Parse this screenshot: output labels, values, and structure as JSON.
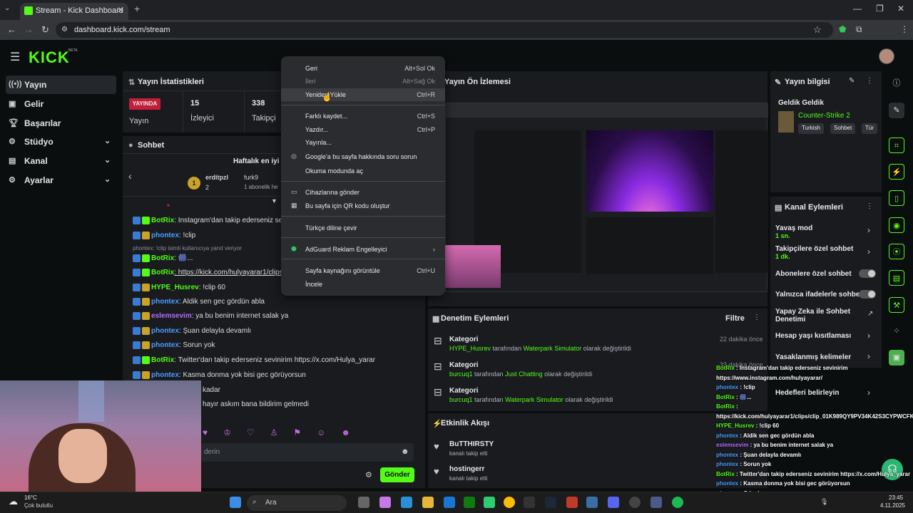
{
  "browser": {
    "tab_title": "Stream - Kick Dashboard",
    "url": "dashboard.kick.com/stream",
    "profile_initial": "H"
  },
  "header": {
    "logo": "KICK",
    "beta": "BETA"
  },
  "sidebar": {
    "items": [
      {
        "label": "Yayın",
        "icon": "radio-icon"
      },
      {
        "label": "Gelir",
        "icon": "money-icon"
      },
      {
        "label": "Başarılar",
        "icon": "trophy-icon"
      },
      {
        "label": "Stüdyo",
        "icon": "studio-icon"
      },
      {
        "label": "Kanal",
        "icon": "channel-icon"
      },
      {
        "label": "Ayarlar",
        "icon": "gear-icon"
      }
    ]
  },
  "stats": {
    "title": "Yayın İstatistikleri",
    "live_badge": "YAYINDA",
    "live_label": "Yayın",
    "viewers_value": "15",
    "viewers_label": "İzleyici",
    "followers_value": "338",
    "followers_label": "Takipçi"
  },
  "chat": {
    "title": "Sohbet",
    "top_title": "Haftalık en iyi h",
    "top1_name": "erditpzl",
    "top1_count": "2",
    "top2_name": "furk9",
    "top2_sub": "1 abonelik he",
    "reply_note": "phontex: !clip isimli kullanıcıya yanıt veriyor",
    "messages": [
      {
        "user": "BotRix",
        "text": ": Instagram'dan takip ederseniz sevi",
        "color": "#53fc18"
      },
      {
        "user": "phontex",
        "text": ": !clip",
        "color": "#4a9eff"
      },
      {
        "user": "BotRix",
        "text": ": 🎆...",
        "color": "#53fc18"
      },
      {
        "user": "BotRix",
        "text": ": https://kick.com/hulyayarar1/clips/c",
        "color": "#53fc18"
      },
      {
        "user": "HYPE_Husrev",
        "text": ": !clip 60",
        "color": "#53fc18"
      },
      {
        "user": "phontex",
        "text": ": Aldik sen gec gördün abla",
        "color": "#4a9eff"
      },
      {
        "user": "eslemsevim",
        "text": ": ya bu benim internet salak ya",
        "color": "#b56cff"
      },
      {
        "user": "phontex",
        "text": ": Şuan delayla devamlı",
        "color": "#4a9eff"
      },
      {
        "user": "phontex",
        "text": ": Sorun yok",
        "color": "#4a9eff"
      },
      {
        "user": "BotRix",
        "text": ": Twitter'dan takip ederseniz sevinirim https://x.com/Hulya_yarar",
        "color": "#53fc18"
      },
      {
        "user": "phontex",
        "text": ": Kasma donma yok bisi gec görüyorsun",
        "color": "#4a9eff"
      }
    ],
    "partial1": "kadar",
    "partial2": "hayır askım bana bildirim gelmedi",
    "input_placeholder": "derin",
    "send_label": "Gönder"
  },
  "preview": {
    "title": "Yayın Ön İzlemesi"
  },
  "info": {
    "title": "Yayın bilgisi",
    "stream_title": "Geldik Geldik",
    "category": "Counter-Strike 2",
    "tags": [
      "Turkish",
      "Sohbet",
      "Tür"
    ]
  },
  "actions": {
    "title": "Kanal Eylemleri",
    "items": [
      {
        "label": "Yavaş mod",
        "sub": "1 sn.",
        "kind": "chev"
      },
      {
        "label": "Takipçilere özel sohbet",
        "sub": "1 dk.",
        "kind": "chev"
      },
      {
        "label": "Abonelere özel sohbet",
        "sub": "",
        "kind": "toggle"
      },
      {
        "label": "Yalnızca ifadelerle sohbet",
        "sub": "",
        "kind": "toggle"
      },
      {
        "label": "Yapay Zeka ile Sohbet Denetimi",
        "sub": "",
        "kind": "ext"
      },
      {
        "label": "Hesap yaşı kısıtlaması",
        "sub": "",
        "kind": "chev"
      },
      {
        "label": "Yasaklanmış kelimeler",
        "sub": "",
        "kind": "chev"
      },
      {
        "label": "Hedefleri belirleyin",
        "sub": "",
        "kind": "chev"
      }
    ]
  },
  "moderation": {
    "title": "Denetim Eylemleri",
    "filter": "Filtre",
    "items": [
      {
        "head": "Kategori",
        "by": "HYPE_Husrev",
        "mid": " tarafından ",
        "cat": "Waterpark Simulator",
        "tail": " olarak değiştirildi",
        "time": "22 dakika önce"
      },
      {
        "head": "Kategori",
        "by": "burcuq1",
        "mid": " tarafından ",
        "cat": "Just Chatting",
        "tail": " olarak değiştirildi",
        "time": "33 dakika önce"
      },
      {
        "head": "Kategori",
        "by": "burcuq1",
        "mid": " tarafından ",
        "cat": "Waterpark Simulator",
        "tail": " olarak değiştirildi",
        "time": ""
      }
    ]
  },
  "activity": {
    "title": "Etkinlik Akışı",
    "items": [
      {
        "name": "BuTTHIRSTY",
        "text": "kanalı takip etti"
      },
      {
        "name": "hostingerr",
        "text": "kanalı takip etti"
      }
    ]
  },
  "context_menu": {
    "items": [
      {
        "label": "Geri",
        "shortcut": "Alt+Sol Ok",
        "disabled": false
      },
      {
        "label": "İleri",
        "shortcut": "Alt+Sağ Ok",
        "disabled": true
      },
      {
        "label": "Yeniden Yükle",
        "shortcut": "Ctrl+R",
        "disabled": false
      },
      {
        "label": "Farklı kaydet...",
        "shortcut": "Ctrl+S",
        "disabled": false
      },
      {
        "label": "Yazdır...",
        "shortcut": "Ctrl+P",
        "disabled": false
      },
      {
        "label": "Yayınla...",
        "shortcut": "",
        "disabled": false
      },
      {
        "label": "Google'a bu sayfa hakkında soru sorun",
        "shortcut": "",
        "disabled": false
      },
      {
        "label": "Okuma modunda aç",
        "shortcut": "",
        "disabled": false
      },
      {
        "label": "Cihazlarına gönder",
        "shortcut": "",
        "disabled": false
      },
      {
        "label": "Bu sayfa için QR kodu oluştur",
        "shortcut": "",
        "disabled": false
      },
      {
        "label": "Türkçe diline çevir",
        "shortcut": "",
        "disabled": false
      },
      {
        "label": "AdGuard Reklam Engelleyici",
        "shortcut": "›",
        "disabled": false
      },
      {
        "label": "Sayfa kaynağını görüntüle",
        "shortcut": "Ctrl+U",
        "disabled": false
      },
      {
        "label": "İncele",
        "shortcut": "",
        "disabled": false
      }
    ]
  },
  "overlay_chat": [
    {
      "user": "BotRix",
      "text": " : Instagram'dan takip ederseniz sevinirim"
    },
    {
      "user": "",
      "text": "https://www.instagram.com/hulyayarar/"
    },
    {
      "user": "phontex",
      "text": " : !clip"
    },
    {
      "user": "BotRix",
      "text": " : 🎆..."
    },
    {
      "user": "BotRix",
      "text": " :"
    },
    {
      "user": "",
      "text": "https://kick.com/hulyayarar1/clips/clip_01K989QY9PV34K42S3CYPWCFKV"
    },
    {
      "user": "HYPE_Husrev",
      "text": " : !clip 60"
    },
    {
      "user": "phontex",
      "text": " : Aldik sen gec gördün abla"
    },
    {
      "user": "eslemsevim",
      "text": " : ya bu benim internet salak ya"
    },
    {
      "user": "phontex",
      "text": " : Şuan delayla devamlı"
    },
    {
      "user": "phontex",
      "text": " : Sorun yok"
    },
    {
      "user": "BotRix",
      "text": " : Twitter'dan takip ederseniz sevinirim https://x.com/Hulya_yarar"
    },
    {
      "user": "phontex",
      "text": " : Kasma donma yok bisi gec görüyorsun"
    },
    {
      "user": "phontex",
      "text": " : O kadar"
    },
    {
      "user": "eslemsevim",
      "text": " : hayır askım bana bildirim gelmedi"
    }
  ],
  "taskbar": {
    "weather_temp": "16°C",
    "weather_desc": "Çok bulutlu",
    "search_placeholder": "Ara",
    "time": "23:45",
    "date": "4.11.2025"
  }
}
